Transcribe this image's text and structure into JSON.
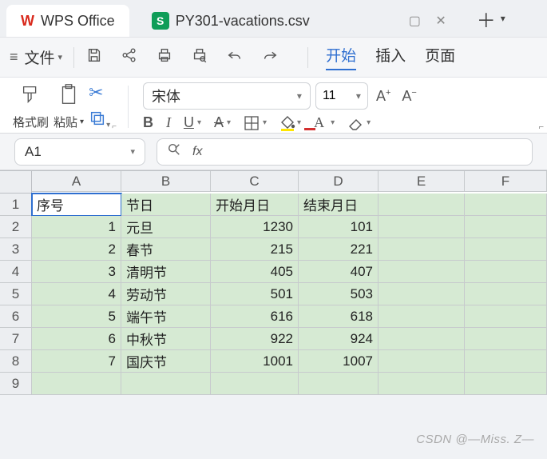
{
  "app": {
    "name": "WPS Office"
  },
  "tab": {
    "filename": "PY301-vacations.csv",
    "badge": "S"
  },
  "menu": {
    "file": "文件",
    "tabs": [
      "开始",
      "插入",
      "页面"
    ],
    "active": 0
  },
  "ribbon": {
    "format_painter": "格式刷",
    "paste": "粘贴",
    "font": "宋体",
    "size": "11"
  },
  "cellref": "A1",
  "columns": [
    "A",
    "B",
    "C",
    "D",
    "E",
    "F"
  ],
  "row_numbers": [
    "1",
    "2",
    "3",
    "4",
    "5",
    "6",
    "7",
    "8",
    "9"
  ],
  "headers": {
    "A": "序号",
    "B": "节日",
    "C": "开始月日",
    "D": "结束月日"
  },
  "rows": [
    {
      "A": "1",
      "B": "元旦",
      "C": "1230",
      "D": "101"
    },
    {
      "A": "2",
      "B": "春节",
      "C": "215",
      "D": "221"
    },
    {
      "A": "3",
      "B": "清明节",
      "C": "405",
      "D": "407"
    },
    {
      "A": "4",
      "B": "劳动节",
      "C": "501",
      "D": "503"
    },
    {
      "A": "5",
      "B": "端午节",
      "C": "616",
      "D": "618"
    },
    {
      "A": "6",
      "B": "中秋节",
      "C": "922",
      "D": "924"
    },
    {
      "A": "7",
      "B": "国庆节",
      "C": "1001",
      "D": "1007"
    }
  ],
  "watermark": "CSDN @—Miss. Z—"
}
